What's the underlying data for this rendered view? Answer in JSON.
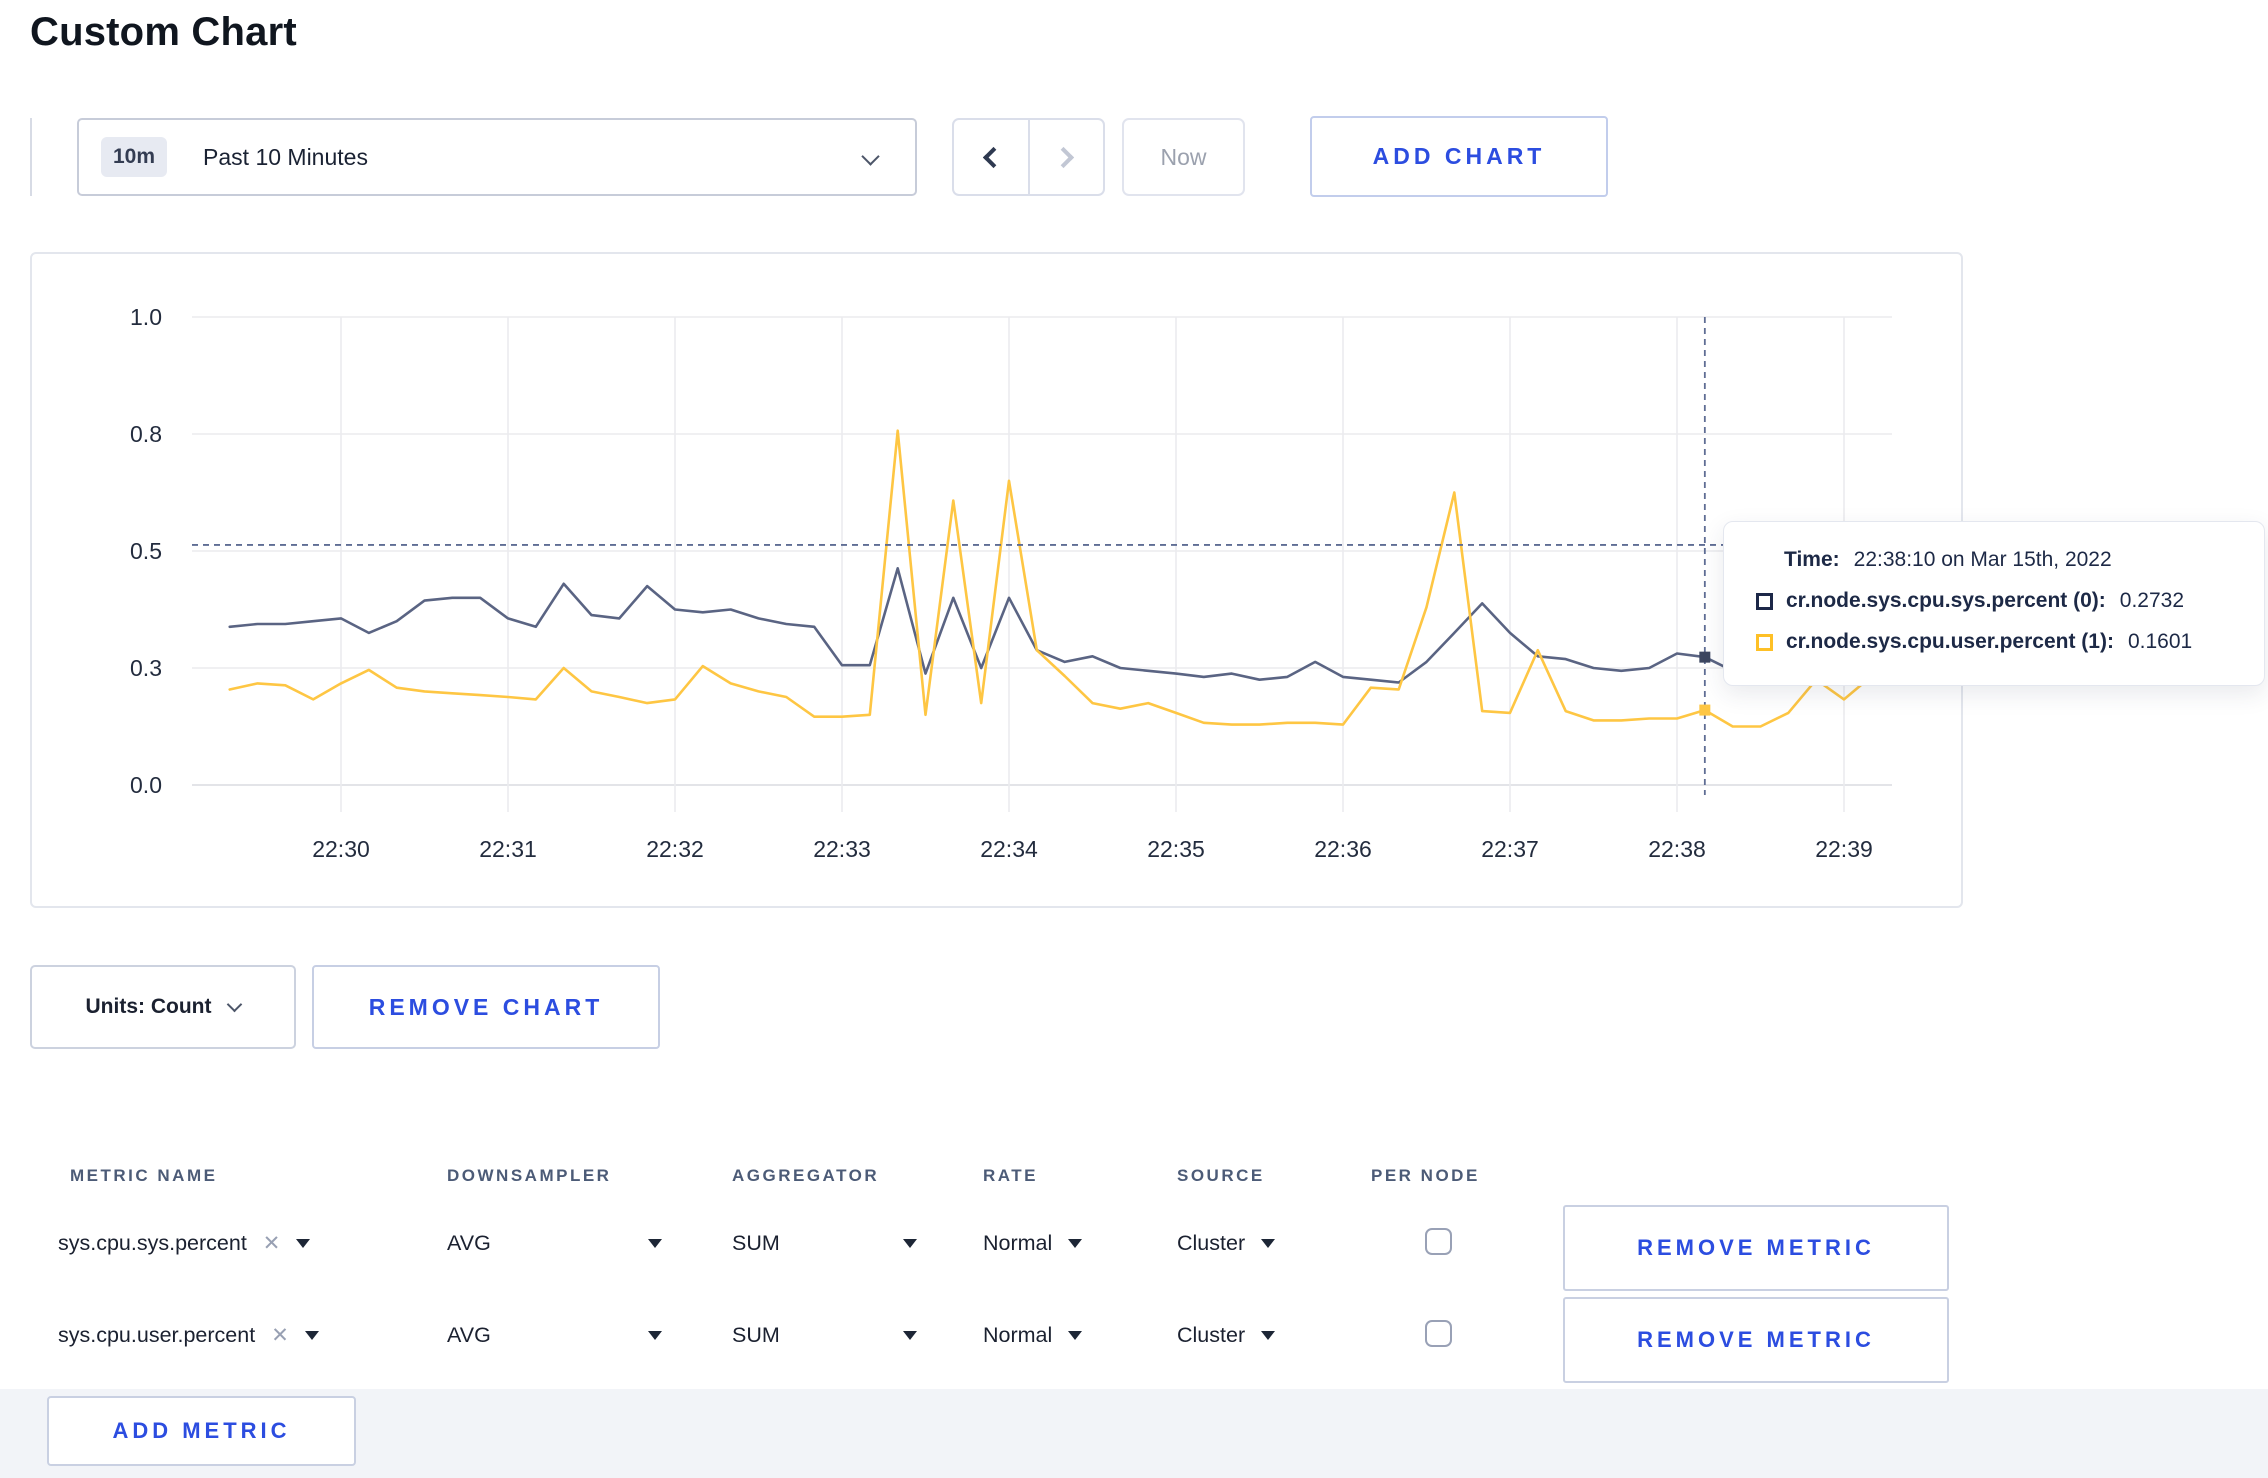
{
  "page": {
    "title": "Custom Chart"
  },
  "toolbar": {
    "time_selector": {
      "badge": "10m",
      "label": "Past 10 Minutes"
    },
    "now_label": "Now",
    "add_chart_label": "ADD CHART"
  },
  "chart_data": {
    "type": "line",
    "title": "",
    "xlabel": "",
    "ylabel": "",
    "x_ticks": [
      "22:30",
      "22:31",
      "22:32",
      "22:33",
      "22:34",
      "22:35",
      "22:36",
      "22:37",
      "22:38",
      "22:39"
    ],
    "y_ticks": [
      "0.0",
      "0.3",
      "0.5",
      "0.8",
      "1.0"
    ],
    "y_tick_values": [
      0,
      0.25,
      0.5,
      0.75,
      1.0
    ],
    "ylim": [
      0,
      1.0
    ],
    "grid": true,
    "x_start_offset_s": -40,
    "x_step_s": 10,
    "series": [
      {
        "name": "cr.node.sys.cpu.sys.percent (0)",
        "color": "#5a6483",
        "values": [
          0.338,
          0.344,
          0.344,
          0.35,
          0.356,
          0.325,
          0.35,
          0.394,
          0.4,
          0.4,
          0.356,
          0.338,
          0.43,
          0.363,
          0.356,
          0.425,
          0.375,
          0.369,
          0.375,
          0.356,
          0.344,
          0.338,
          0.256,
          0.256,
          0.463,
          0.238,
          0.4,
          0.25,
          0.4,
          0.288,
          0.263,
          0.275,
          0.25,
          0.244,
          0.238,
          0.231,
          0.238,
          0.225,
          0.231,
          0.263,
          0.231,
          0.225,
          0.219,
          0.263,
          0.325,
          0.388,
          0.325,
          0.275,
          0.269,
          0.25,
          0.244,
          0.25,
          0.281,
          0.2732,
          0.244,
          0.25,
          0.244,
          0.25,
          0.25,
          0.256
        ]
      },
      {
        "name": "cr.node.sys.cpu.user.percent (1)",
        "color": "#fec643",
        "values": [
          0.204,
          0.217,
          0.213,
          0.183,
          0.217,
          0.246,
          0.208,
          0.2,
          0.196,
          0.192,
          0.188,
          0.183,
          0.25,
          0.2,
          0.188,
          0.175,
          0.183,
          0.254,
          0.217,
          0.2,
          0.188,
          0.146,
          0.146,
          0.15,
          0.757,
          0.15,
          0.608,
          0.175,
          0.65,
          0.288,
          0.233,
          0.175,
          0.163,
          0.175,
          0.154,
          0.133,
          0.129,
          0.129,
          0.133,
          0.133,
          0.129,
          0.208,
          0.204,
          0.38,
          0.625,
          0.158,
          0.154,
          0.288,
          0.158,
          0.138,
          0.138,
          0.142,
          0.142,
          0.1601,
          0.125,
          0.125,
          0.154,
          0.225,
          0.183,
          0.233
        ]
      }
    ],
    "crosshair": {
      "time_offset_s": 490,
      "hline_value": 0.513,
      "highlight_values": [
        0.2732,
        0.1601
      ],
      "dash_color": "#5f6d94"
    },
    "tooltip": {
      "time_label": "Time:",
      "time_value": "22:38:10 on Mar 15th, 2022",
      "rows": [
        {
          "name": "cr.node.sys.cpu.sys.percent (0):",
          "value": "0.2732",
          "color": "#1c2848"
        },
        {
          "name": "cr.node.sys.cpu.user.percent (1):",
          "value": "0.1601",
          "color": "#fec026"
        }
      ]
    },
    "colors": {
      "grid": "#ebebee",
      "axis_text": "#232c3e"
    },
    "legend_position": "tooltip-only"
  },
  "chart_controls": {
    "units_label": "Units: Count",
    "remove_chart_label": "REMOVE CHART"
  },
  "metrics_table": {
    "headers": [
      "METRIC NAME",
      "DOWNSAMPLER",
      "AGGREGATOR",
      "RATE",
      "SOURCE",
      "PER NODE"
    ],
    "rows": [
      {
        "metric": "sys.cpu.sys.percent",
        "remove_x": "✕",
        "downsampler": "AVG",
        "aggregator": "SUM",
        "rate": "Normal",
        "source": "Cluster",
        "per_node_checked": false,
        "remove_label": "REMOVE METRIC"
      },
      {
        "metric": "sys.cpu.user.percent",
        "remove_x": "✕",
        "downsampler": "AVG",
        "aggregator": "SUM",
        "rate": "Normal",
        "source": "Cluster",
        "per_node_checked": false,
        "remove_label": "REMOVE METRIC"
      }
    ],
    "add_metric_label": "ADD METRIC"
  }
}
